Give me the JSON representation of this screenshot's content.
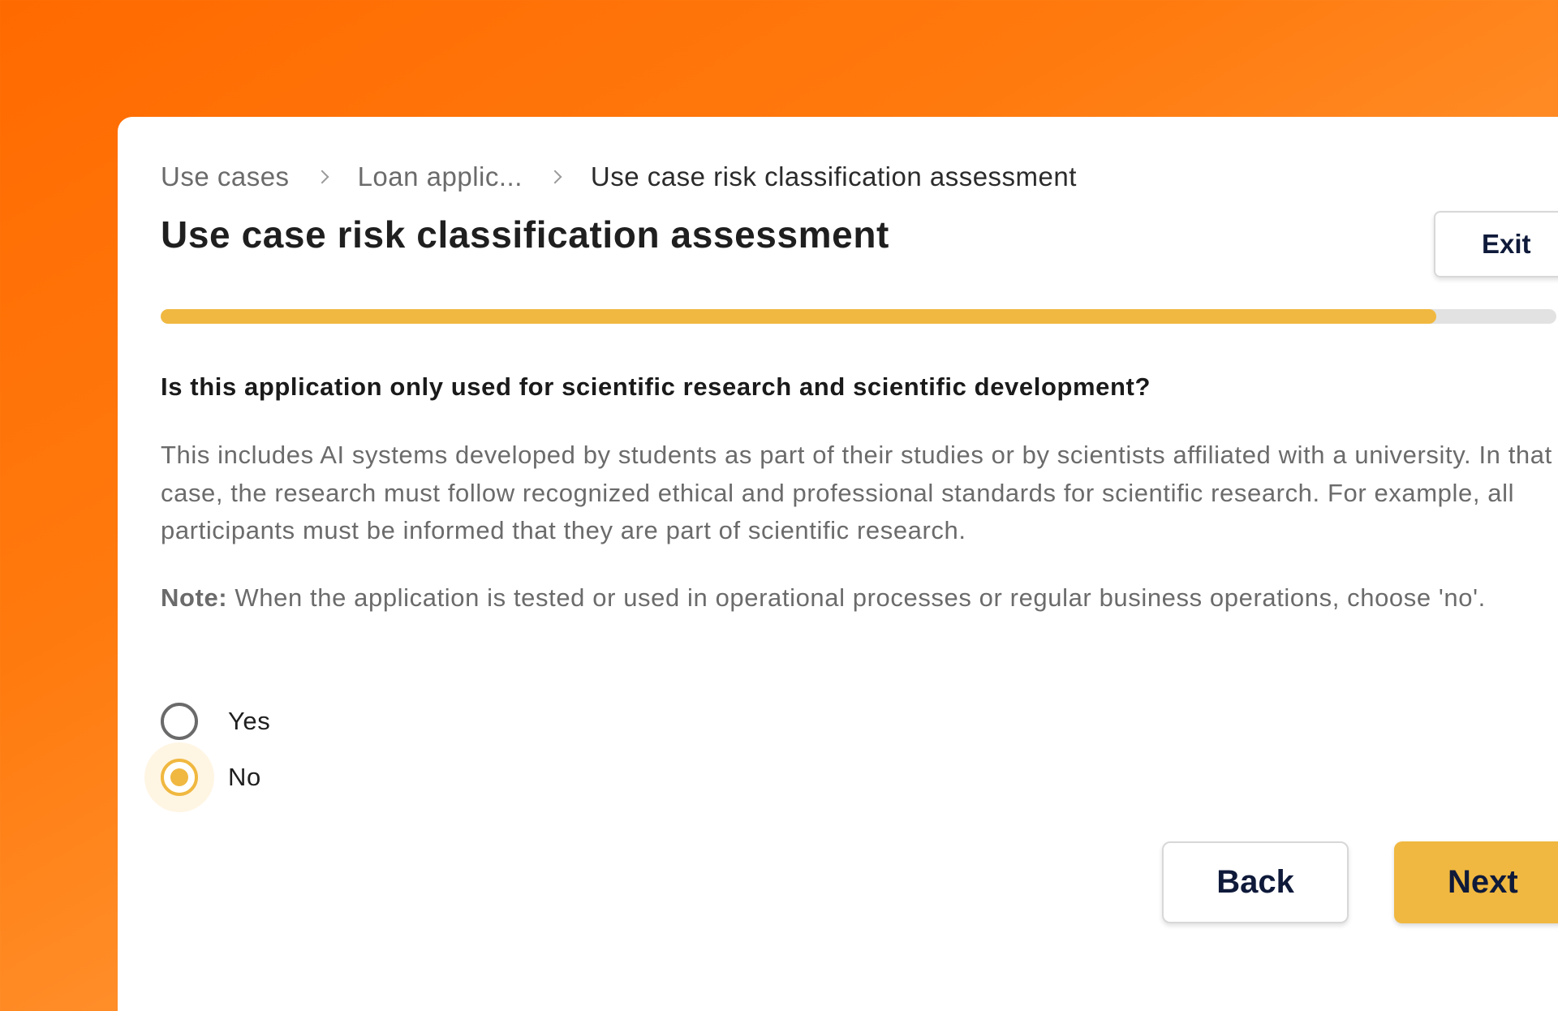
{
  "breadcrumb": {
    "items": [
      "Use cases",
      "Loan applic...",
      "Use case risk classification assessment"
    ]
  },
  "page": {
    "title": "Use case risk classification assessment"
  },
  "header": {
    "exit_label": "Exit"
  },
  "progress": {
    "fraction": 0.914
  },
  "question": {
    "text": "Is this application only used for scientific research and scientific development?",
    "description": "This includes AI systems developed by students as part of their studies or by scientists affiliated with a university. In that case, the research must follow recognized ethical and professional standards for scientific research. For example, all participants must be informed that they are part of scientific research.",
    "note_label": "Note:",
    "note_text": " When the application is tested or used in operational processes or regular business operations, choose 'no'."
  },
  "options": [
    {
      "label": "Yes",
      "selected": false
    },
    {
      "label": "No",
      "selected": true
    }
  ],
  "footer": {
    "back_label": "Back",
    "next_label": "Next"
  },
  "colors": {
    "accent": "#f0b840",
    "background_start": "#ff6a00",
    "background_end": "#ffb04e",
    "button_text": "#0f1a3a"
  }
}
